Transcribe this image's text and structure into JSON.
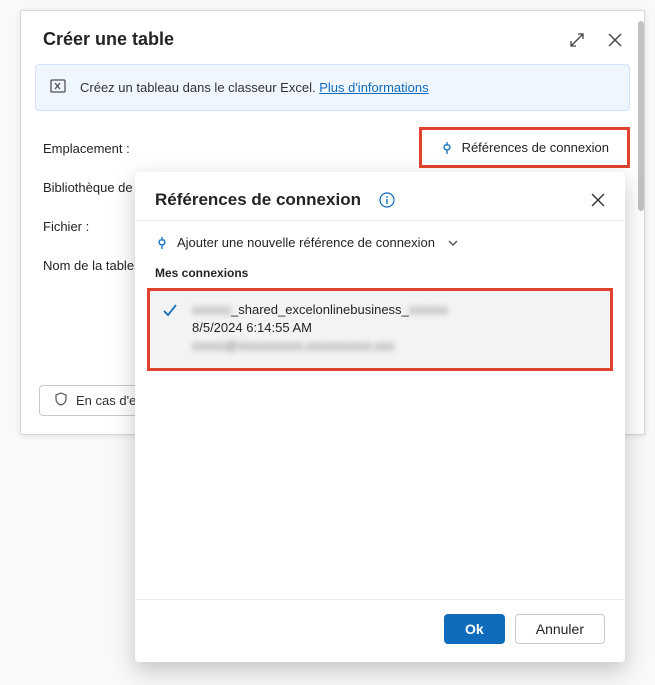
{
  "dialog": {
    "title": "Créer une table",
    "info_prefix": "Créez un tableau dans le classeur Excel. ",
    "info_link": "Plus d'informations",
    "references_btn": "Références de connexion",
    "form": {
      "location_label": "Emplacement :",
      "library_label": "Bibliothèque de",
      "file_label": "Fichier :",
      "tablename_label": "Nom de la table"
    },
    "privacy_btn": "En cas d'er"
  },
  "popover": {
    "title": "Références de connexion",
    "add_ref": "Ajouter une nouvelle référence de connexion",
    "section_label": "Mes connexions",
    "connection": {
      "line1_prefix": "xxxxxx",
      "line1_mid": "_shared_excelonlinebusiness_",
      "line1_suffix": "xxxxxx",
      "line2": "8/5/2024 6:14:55 AM",
      "line3": "xxxxx@xxxxxxxxxx.xxxxxxxxxx.xxx"
    },
    "ok": "Ok",
    "cancel": "Annuler"
  }
}
